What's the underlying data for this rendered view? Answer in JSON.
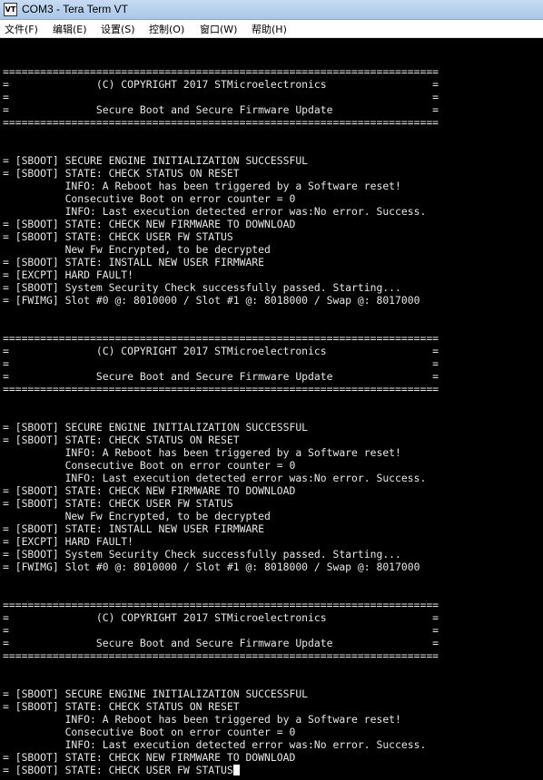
{
  "window": {
    "icon_text": "VT",
    "title": "COM3 - Tera Term VT"
  },
  "menubar": {
    "items": [
      {
        "label": "文件(F)"
      },
      {
        "label": "编辑(E)"
      },
      {
        "label": "设置(S)"
      },
      {
        "label": "控制(O)"
      },
      {
        "label": "窗口(W)"
      },
      {
        "label": "帮助(H)"
      }
    ]
  },
  "terminal": {
    "lines": [
      "",
      "",
      "======================================================================",
      "=              (C) COPYRIGHT 2017 STMicroelectronics                 =",
      "=                                                                    =",
      "=              Secure Boot and Secure Firmware Update                =",
      "======================================================================",
      "",
      "",
      "= [SBOOT] SECURE ENGINE INITIALIZATION SUCCESSFUL",
      "= [SBOOT] STATE: CHECK STATUS ON RESET",
      "          INFO: A Reboot has been triggered by a Software reset!",
      "          Consecutive Boot on error counter = 0",
      "          INFO: Last execution detected error was:No error. Success.",
      "= [SBOOT] STATE: CHECK NEW FIRMWARE TO DOWNLOAD",
      "= [SBOOT] STATE: CHECK USER FW STATUS",
      "          New Fw Encrypted, to be decrypted",
      "= [SBOOT] STATE: INSTALL NEW USER FIRMWARE",
      "= [EXCPT] HARD FAULT!",
      "= [SBOOT] System Security Check successfully passed. Starting...",
      "= [FWIMG] Slot #0 @: 8010000 / Slot #1 @: 8018000 / Swap @: 8017000",
      "",
      "",
      "======================================================================",
      "=              (C) COPYRIGHT 2017 STMicroelectronics                 =",
      "=                                                                    =",
      "=              Secure Boot and Secure Firmware Update                =",
      "======================================================================",
      "",
      "",
      "= [SBOOT] SECURE ENGINE INITIALIZATION SUCCESSFUL",
      "= [SBOOT] STATE: CHECK STATUS ON RESET",
      "          INFO: A Reboot has been triggered by a Software reset!",
      "          Consecutive Boot on error counter = 0",
      "          INFO: Last execution detected error was:No error. Success.",
      "= [SBOOT] STATE: CHECK NEW FIRMWARE TO DOWNLOAD",
      "= [SBOOT] STATE: CHECK USER FW STATUS",
      "          New Fw Encrypted, to be decrypted",
      "= [SBOOT] STATE: INSTALL NEW USER FIRMWARE",
      "= [EXCPT] HARD FAULT!",
      "= [SBOOT] System Security Check successfully passed. Starting...",
      "= [FWIMG] Slot #0 @: 8010000 / Slot #1 @: 8018000 / Swap @: 8017000",
      "",
      "",
      "======================================================================",
      "=              (C) COPYRIGHT 2017 STMicroelectronics                 =",
      "=                                                                    =",
      "=              Secure Boot and Secure Firmware Update                =",
      "======================================================================",
      "",
      "",
      "= [SBOOT] SECURE ENGINE INITIALIZATION SUCCESSFUL",
      "= [SBOOT] STATE: CHECK STATUS ON RESET",
      "          INFO: A Reboot has been triggered by a Software reset!",
      "          Consecutive Boot on error counter = 0",
      "          INFO: Last execution detected error was:No error. Success.",
      "= [SBOOT] STATE: CHECK NEW FIRMWARE TO DOWNLOAD",
      "= [SBOOT] STATE: CHECK USER FW STATUS"
    ]
  }
}
